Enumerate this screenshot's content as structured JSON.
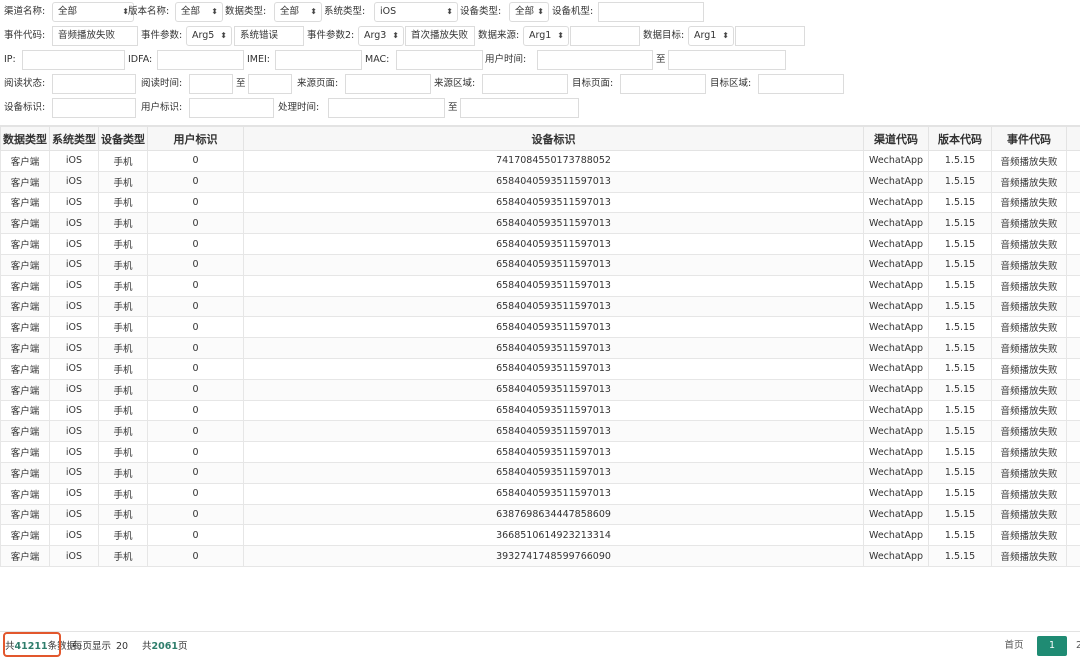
{
  "filters": {
    "row1": {
      "channel_label": "渠道名称:",
      "channel_value": "全部",
      "version_label": "版本名称:",
      "version_value": "全部",
      "datatype_label": "数据类型:",
      "datatype_value": "全部",
      "systype_label": "系统类型:",
      "systype_value": "iOS",
      "devtype_label": "设备类型:",
      "devtype_value": "全部",
      "devmodel_label": "设备机型:",
      "devmodel_value": ""
    },
    "row2": {
      "eventcode_label": "事件代码:",
      "eventcode_value": "音频播放失败",
      "param_label": "事件参数:",
      "param_select": "Arg5",
      "param_value": "系统错误",
      "param2_label": "事件参数2:",
      "param2_select": "Arg3",
      "param2_value": "首次播放失败",
      "source_label": "数据来源:",
      "source_select": "Arg1",
      "source_value": "",
      "target_label": "数据目标:",
      "target_select": "Arg1",
      "target_value": ""
    },
    "row3": {
      "ip_label": "IP:",
      "idfa_label": "IDFA:",
      "imei_label": "IMEI:",
      "mac_label": "MAC:",
      "usertime_label": "用户时间:",
      "to_label": "至"
    },
    "row4": {
      "readstatus_label": "阅读状态:",
      "readtime_label": "阅读时间:",
      "to_label": "至",
      "srcpage_label": "来源页面:",
      "srcarea_label": "来源区域:",
      "tgtpage_label": "目标页面:",
      "tgtarea_label": "目标区域:"
    },
    "row5": {
      "deviceid_label": "设备标识:",
      "userid_label": "用户标识:",
      "proctime_label": "处理时间:",
      "to_label": "至"
    }
  },
  "table": {
    "headers": [
      "数据类型",
      "系统类型",
      "设备类型",
      "用户标识",
      "设备标识",
      "渠道代码",
      "版本代码",
      "事件代码"
    ],
    "rows": [
      [
        "客户端",
        "iOS",
        "手机",
        "0",
        "7417084550173788052",
        "WechatApp",
        "1.5.15",
        "音频播放失败"
      ],
      [
        "客户端",
        "iOS",
        "手机",
        "0",
        "6584040593511597013",
        "WechatApp",
        "1.5.15",
        "音频播放失败"
      ],
      [
        "客户端",
        "iOS",
        "手机",
        "0",
        "6584040593511597013",
        "WechatApp",
        "1.5.15",
        "音频播放失败"
      ],
      [
        "客户端",
        "iOS",
        "手机",
        "0",
        "6584040593511597013",
        "WechatApp",
        "1.5.15",
        "音频播放失败"
      ],
      [
        "客户端",
        "iOS",
        "手机",
        "0",
        "6584040593511597013",
        "WechatApp",
        "1.5.15",
        "音频播放失败"
      ],
      [
        "客户端",
        "iOS",
        "手机",
        "0",
        "6584040593511597013",
        "WechatApp",
        "1.5.15",
        "音频播放失败"
      ],
      [
        "客户端",
        "iOS",
        "手机",
        "0",
        "6584040593511597013",
        "WechatApp",
        "1.5.15",
        "音频播放失败"
      ],
      [
        "客户端",
        "iOS",
        "手机",
        "0",
        "6584040593511597013",
        "WechatApp",
        "1.5.15",
        "音频播放失败"
      ],
      [
        "客户端",
        "iOS",
        "手机",
        "0",
        "6584040593511597013",
        "WechatApp",
        "1.5.15",
        "音频播放失败"
      ],
      [
        "客户端",
        "iOS",
        "手机",
        "0",
        "6584040593511597013",
        "WechatApp",
        "1.5.15",
        "音频播放失败"
      ],
      [
        "客户端",
        "iOS",
        "手机",
        "0",
        "6584040593511597013",
        "WechatApp",
        "1.5.15",
        "音频播放失败"
      ],
      [
        "客户端",
        "iOS",
        "手机",
        "0",
        "6584040593511597013",
        "WechatApp",
        "1.5.15",
        "音频播放失败"
      ],
      [
        "客户端",
        "iOS",
        "手机",
        "0",
        "6584040593511597013",
        "WechatApp",
        "1.5.15",
        "音频播放失败"
      ],
      [
        "客户端",
        "iOS",
        "手机",
        "0",
        "6584040593511597013",
        "WechatApp",
        "1.5.15",
        "音频播放失败"
      ],
      [
        "客户端",
        "iOS",
        "手机",
        "0",
        "6584040593511597013",
        "WechatApp",
        "1.5.15",
        "音频播放失败"
      ],
      [
        "客户端",
        "iOS",
        "手机",
        "0",
        "6584040593511597013",
        "WechatApp",
        "1.5.15",
        "音频播放失败"
      ],
      [
        "客户端",
        "iOS",
        "手机",
        "0",
        "6584040593511597013",
        "WechatApp",
        "1.5.15",
        "音频播放失败"
      ],
      [
        "客户端",
        "iOS",
        "手机",
        "0",
        "6387698634447858609",
        "WechatApp",
        "1.5.15",
        "音频播放失败"
      ],
      [
        "客户端",
        "iOS",
        "手机",
        "0",
        "3668510614923213314",
        "WechatApp",
        "1.5.15",
        "音频播放失败"
      ],
      [
        "客户端",
        "iOS",
        "手机",
        "0",
        "3932741748599766090",
        "WechatApp",
        "1.5.15",
        "音频播放失败"
      ]
    ]
  },
  "footer": {
    "total_prefix": "共",
    "total_count": "41211",
    "total_suffix": "条数据",
    "per_page_label": "每页显示",
    "per_page_value": "20",
    "pages_prefix": "共",
    "pages_count": "2061",
    "pages_suffix": "页",
    "first_label": "首页",
    "current_page": "1",
    "next_label": "2"
  },
  "colors": {
    "accent": "#1f8b73",
    "highlight": "#e2572d",
    "count_text": "#2e7d6b"
  }
}
